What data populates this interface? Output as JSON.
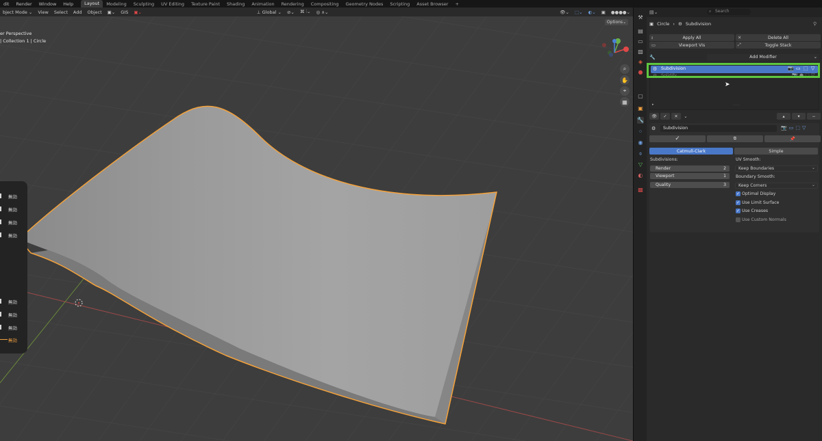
{
  "menu": {
    "items": [
      "dit",
      "Render",
      "Window",
      "Help"
    ]
  },
  "workspaces": [
    "Layout",
    "Modeling",
    "Sculpting",
    "UV Editing",
    "Texture Paint",
    "Shading",
    "Animation",
    "Rendering",
    "Compositing",
    "Geometry Nodes",
    "Scripting",
    "Asset Browser",
    "+"
  ],
  "viewport_header": {
    "mode": "bject Mode",
    "menus": [
      "View",
      "Select",
      "Add",
      "Object"
    ],
    "gis": "GIS",
    "orientation": "Global",
    "options": "Options"
  },
  "overlay": {
    "perspective": "er Perspective",
    "collection": "| Collection 1 | Circle"
  },
  "left_panel": {
    "items": [
      "無効",
      "無効",
      "無効",
      "無効",
      "無効",
      "無効",
      "無効",
      "無効"
    ]
  },
  "search": {
    "placeholder": "Search"
  },
  "breadcrumb": {
    "object": "Circle",
    "modifier": "Subdivision"
  },
  "stack_buttons": {
    "apply_all": "Apply All",
    "delete_all": "Delete All",
    "viewport_vis": "Viewport Vis",
    "toggle_stack": "Toggle Stack"
  },
  "add_modifier": "Add Modifier",
  "modifier_list": {
    "selected": "Subdivision",
    "second": "Solidify"
  },
  "modifier_panel": {
    "name": "Subdivision",
    "tabs": [
      "Catmull-Clark",
      "Simple"
    ],
    "subdivisions_label": "Subdivisions:",
    "render_label": "Render",
    "render_value": "2",
    "viewport_label": "Viewport",
    "viewport_value": "1",
    "quality_label": "Quality",
    "quality_value": "3",
    "uv_smooth_label": "UV Smooth:",
    "uv_smooth_value": "Keep Boundaries",
    "boundary_smooth_label": "Boundary Smooth:",
    "boundary_smooth_value": "Keep Corners",
    "checks": [
      {
        "label": "Optimal Display",
        "checked": true
      },
      {
        "label": "Use Limit Surface",
        "checked": true
      },
      {
        "label": "Use Creases",
        "checked": true
      },
      {
        "label": "Use Custom Normals",
        "checked": false
      }
    ]
  },
  "colors": {
    "highlight": "#5ec640",
    "selection": "#4a78c8",
    "outline": "#f5a23a"
  }
}
